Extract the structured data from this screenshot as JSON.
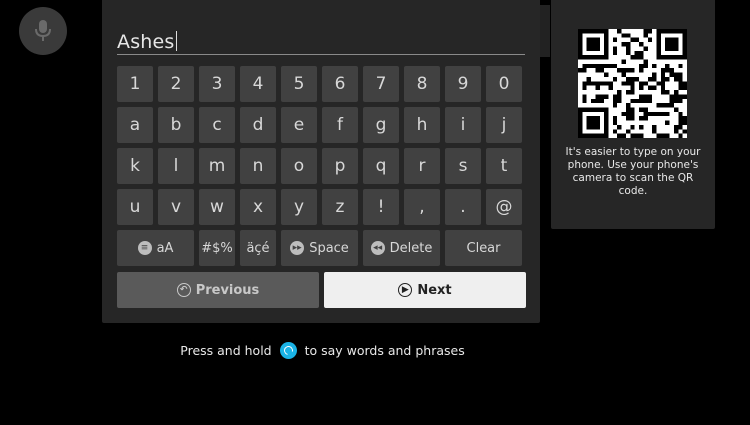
{
  "search": {
    "value": "Ashes"
  },
  "keyboard": {
    "row1": [
      "1",
      "2",
      "3",
      "4",
      "5",
      "6",
      "7",
      "8",
      "9",
      "0"
    ],
    "row2": [
      "a",
      "b",
      "c",
      "d",
      "e",
      "f",
      "g",
      "h",
      "i",
      "j"
    ],
    "row3": [
      "k",
      "l",
      "m",
      "n",
      "o",
      "p",
      "q",
      "r",
      "s",
      "t"
    ],
    "row4": [
      "u",
      "v",
      "w",
      "x",
      "y",
      "z",
      "!",
      ",",
      ".",
      "@"
    ],
    "case_label": "aA",
    "symbols_label": "#$%",
    "accents_label": "äçé",
    "space_label": "Space",
    "delete_label": "Delete",
    "clear_label": "Clear"
  },
  "nav": {
    "previous_label": "Previous",
    "next_label": "Next"
  },
  "qr_panel": {
    "text": "It's easier to type on your phone. Use your phone's camera to scan the QR code."
  },
  "hint": {
    "before": "Press and hold",
    "after": "to say words and phrases"
  },
  "icons": {
    "mic": "microphone-icon",
    "case": "menu-icon",
    "space": "fast-forward-icon",
    "delete": "rewind-icon",
    "previous": "back-icon",
    "next": "play-pause-icon",
    "alexa": "alexa-icon"
  },
  "colors": {
    "alexa": "#1ab3e6",
    "panel": "#262626",
    "key": "#414141"
  }
}
